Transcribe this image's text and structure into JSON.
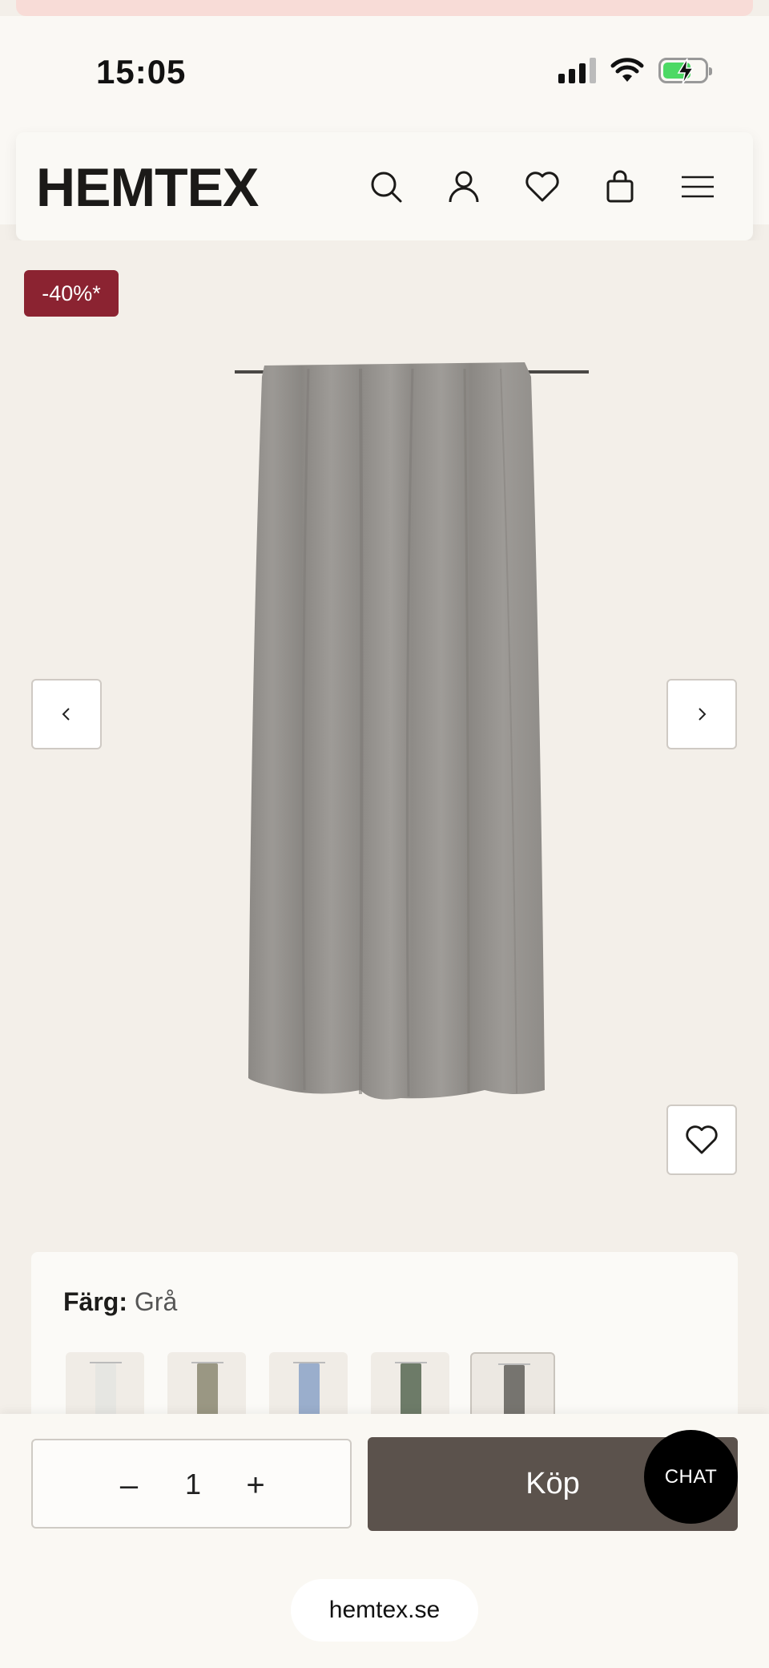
{
  "status_bar": {
    "time": "15:05",
    "battery_color": "#4cd964"
  },
  "header": {
    "logo": "HEMTEX",
    "icons": [
      "search-icon",
      "account-icon",
      "heart-icon",
      "bag-icon",
      "menu-icon"
    ]
  },
  "gallery": {
    "badge": "-40%*",
    "badge_color": "#8b2331",
    "prev_icon": "chevron-left-icon",
    "next_icon": "chevron-right-icon",
    "wishlist_icon": "heart-icon"
  },
  "color_selector": {
    "label": "Färg:",
    "value": "Grå",
    "swatches": [
      {
        "color": "#e6e6e2"
      },
      {
        "color": "#9a9783"
      },
      {
        "color": "#9aaecc"
      },
      {
        "color": "#6d7b68"
      },
      {
        "color": "#76746f",
        "selected": true
      }
    ]
  },
  "buy_bar": {
    "quantity": "1",
    "minus_symbol": "–",
    "plus_symbol": "+",
    "buy_label": "Köp",
    "buy_color": "#5b524c",
    "chat_label": "CHAT"
  },
  "browser": {
    "url": "hemtex.se"
  }
}
